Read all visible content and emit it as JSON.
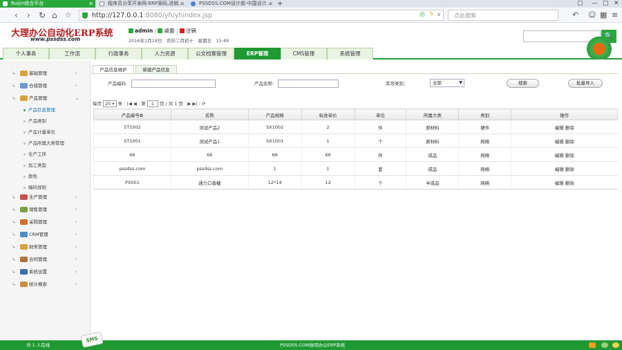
{
  "browser": {
    "tabs": [
      {
        "title": "Ruijin综合平台",
        "active": true
      },
      {
        "title": "程序员分享开发网-ERP源码,进销...",
        "active": false
      },
      {
        "title": "PSSDSS.COM设计部-中国设计...",
        "active": false
      }
    ],
    "url_host": "http://127.0.0.1",
    "url_path": ":8080/yh/yhindex.jsp",
    "search_placeholder": "点此搜索",
    "colors": {
      "accent": "#2aa83e"
    }
  },
  "header": {
    "logo": "大理办公自动化ERP系统",
    "logo_sub": "www.pssdss.com",
    "user": "admin",
    "desktop": "桌面",
    "logout": "注销",
    "date": "2016年1月18日　农历二月初十　星期五　15:49",
    "search_button": "🔍"
  },
  "menu": [
    "个人事务",
    "工作流",
    "行政事务",
    "人力资源",
    "公文档案管理",
    "ERP管理",
    "CMS管理",
    "系统管理"
  ],
  "active_menu": "ERP管理",
  "sidebar": {
    "groups_top": [
      {
        "label": "基础管理"
      },
      {
        "label": "仓储管理"
      },
      {
        "label": "产品管理"
      }
    ],
    "subitems": [
      "产品信息管理",
      "产品类别",
      "产品计量单位",
      "产品所属大类管理",
      "生产工序",
      "加工类型",
      "颜色",
      "编码规则"
    ],
    "groups_bottom": [
      {
        "label": "生产管理"
      },
      {
        "label": "销售管理"
      },
      {
        "label": "采购管理"
      },
      {
        "label": "CRM管理"
      },
      {
        "label": "财务管理"
      },
      {
        "label": "合同管理"
      },
      {
        "label": "系统设置"
      },
      {
        "label": "统计报表"
      }
    ]
  },
  "content": {
    "tabs": [
      "产品信息维护",
      "新建产品信息"
    ],
    "filters": {
      "code_label": "产品编码:",
      "name_label": "产品名称:",
      "type_label": "库存类别：",
      "type_value": "全部",
      "search_btn": "搜索",
      "import_btn": "批量导入"
    },
    "pager": {
      "prefix": "每页",
      "per_page": "20",
      "unit": "条",
      "first": "|◀",
      "prev": "◀",
      "page_label": "第",
      "page": "1",
      "of": "页 / 共 1 页",
      "next": "▶",
      "last": "▶|",
      "refresh": "⟳"
    },
    "columns": [
      "产品编号✿",
      "名称",
      "产品规格",
      "标准单价",
      "单位",
      "所属大类",
      "类别",
      "操作"
    ],
    "rows": [
      [
        "ST1002",
        "测试产品2",
        "SX1002",
        "2",
        "件",
        "原材料",
        "硬件",
        "编辑 删除"
      ],
      [
        "ST1001",
        "测试产品1",
        "SX1001",
        "1",
        "个",
        "原材料",
        "网络",
        "编辑 删除"
      ],
      [
        "66",
        "66",
        "66",
        "66",
        "件",
        "成品",
        "网络",
        "编辑 删除"
      ],
      [
        "pssdss.com",
        "pssdss.com",
        "1",
        "1",
        "套",
        "成品",
        "网络",
        "编辑 删除"
      ],
      [
        "PX001",
        "通力口香糖",
        "12*14",
        "12",
        "个",
        "半成品",
        "网络",
        "编辑 删除"
      ]
    ]
  },
  "status": {
    "online": "共 1 人在线",
    "center": "PSSDSS.COM协同办公ERP系统",
    "sms": "SMS"
  }
}
